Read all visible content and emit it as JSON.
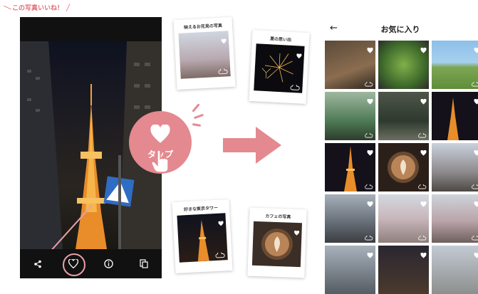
{
  "callout": {
    "text": "この写真いいね！"
  },
  "tap": {
    "label": "タップ"
  },
  "polaroids": [
    {
      "caption": "映えるお花見の写真"
    },
    {
      "caption": "夏の思い出"
    },
    {
      "caption": "好きな東京タワー"
    },
    {
      "caption": "カフェの写真"
    }
  ],
  "favorites": {
    "title": "お気に入り",
    "back_icon": "arrow-left-icon"
  },
  "bottom_bar": {
    "icons": [
      "share-icon",
      "heart-icon",
      "info-icon",
      "details-icon"
    ]
  },
  "colors": {
    "accent": "#e4898f",
    "accent_light": "#e8a0a6",
    "callout": "#e06b74"
  }
}
